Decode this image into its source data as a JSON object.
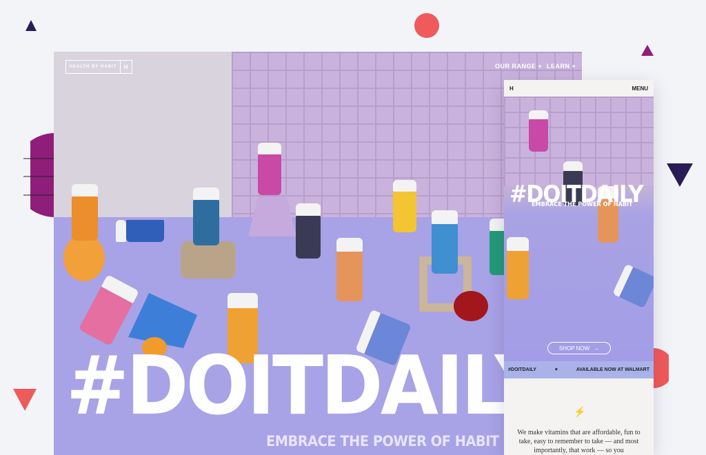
{
  "desktop": {
    "logo_text": "HEALTH BY HABIT",
    "logo_mark": "H",
    "nav": [
      {
        "label": "OUR RANGE +"
      },
      {
        "label": "LEARN +"
      }
    ],
    "hero_tag": "#DOITDAILY",
    "hero_subtitle": "EMBRACE THE POWER OF HABIT"
  },
  "mobile": {
    "logo_mark": "H",
    "menu_label": "MENU",
    "hero_tag": "#DOITDAILY",
    "hero_subtitle": "EMBRACE THE POWER OF HABIT",
    "shop_button": "SHOP NOW",
    "band_left": "#DOITDAILY",
    "band_right": "AVAILABLE NOW AT WALMART",
    "copy": "We make vitamins that are affordable, fun to take, easy to remember to take — and most importantly, that work — so you"
  },
  "colors": {
    "accent_red": "#ef5a5a",
    "accent_purple": "#8e1e7a",
    "dark_navy": "#2a1d55"
  }
}
